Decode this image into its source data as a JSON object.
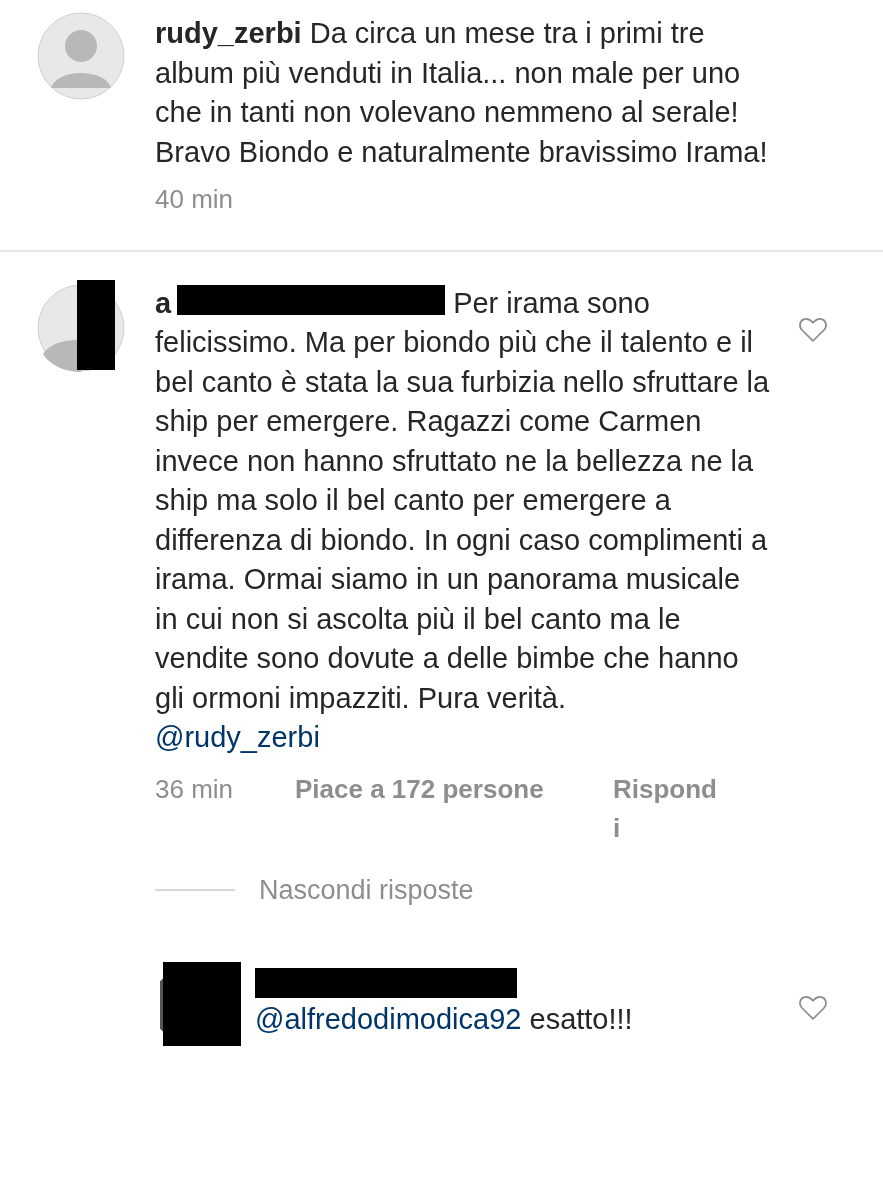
{
  "post": {
    "username": "rudy_zerbi",
    "caption": "Da circa un mese tra i primi tre album più venduti in Italia... non male per uno che in tanti non volevano nemmeno al serale! Bravo Biondo e naturalmente bravissimo Irama!",
    "time": "40 min"
  },
  "comment": {
    "username": "a",
    "text": "Per irama sono felicissimo. Ma per biondo più che il talento e il bel canto è stata la sua furbizia nello sfruttare la ship per emergere. Ragazzi come Carmen invece non hanno sfruttato ne la bellezza ne la ship ma solo il bel canto per emergere a differenza di biondo. In ogni caso complimenti a irama. Ormai siamo in un panorama musicale in cui non si ascolta più il bel canto ma le vendite sono dovute a delle bimbe che hanno gli ormoni impazziti. Pura verità.",
    "mention": "@rudy_zerbi",
    "time": "36 min",
    "likes": "Piace a 172 persone",
    "reply": "Rispondi",
    "liked": false
  },
  "hide_replies": "Nascondi risposte",
  "replies": [
    {
      "mention": "@alfredodimodica92",
      "text": "esatto!!!",
      "liked": false
    }
  ]
}
